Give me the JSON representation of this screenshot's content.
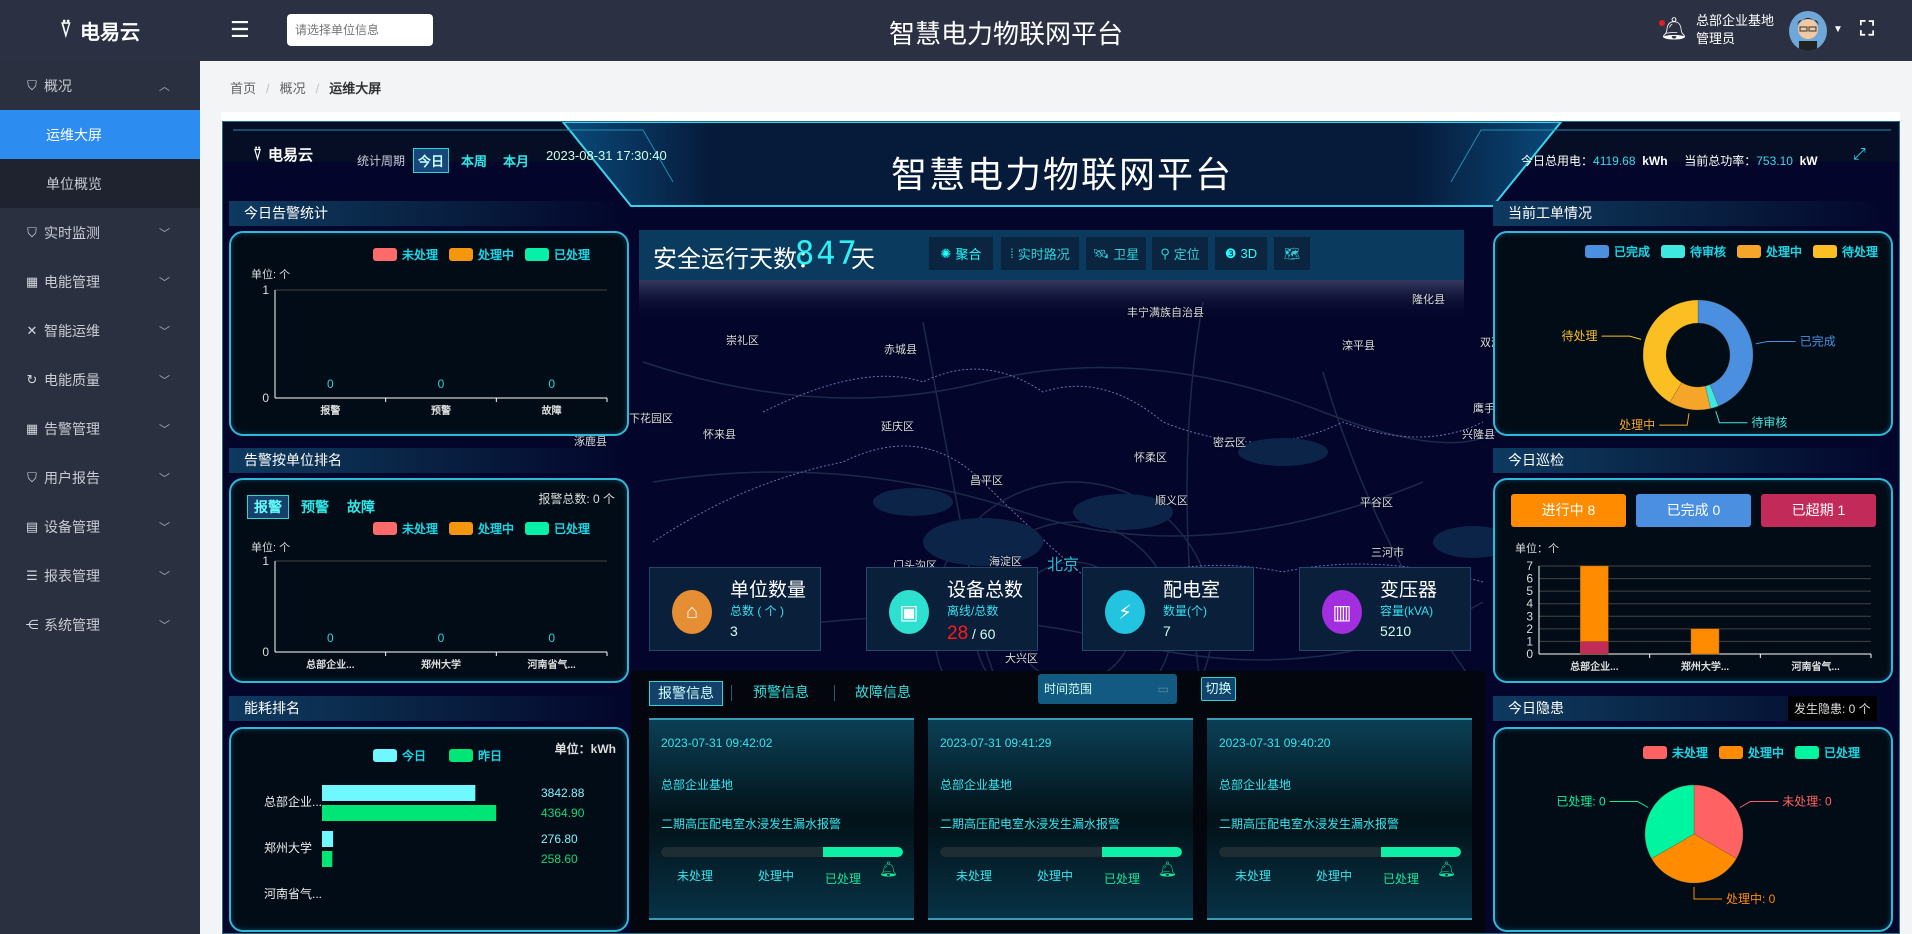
{
  "sidebar": {
    "logo": "电易云",
    "items": [
      {
        "label": "概况",
        "icon": "shield-icon",
        "expanded": true,
        "children": [
          {
            "label": "运维大屏",
            "active": true
          },
          {
            "label": "单位概览"
          }
        ]
      },
      {
        "label": "实时监测",
        "icon": "shield-icon"
      },
      {
        "label": "电能管理",
        "icon": "grid-icon"
      },
      {
        "label": "智能运维",
        "icon": "tools-icon"
      },
      {
        "label": "电能质量",
        "icon": "power-cycle-icon"
      },
      {
        "label": "告警管理",
        "icon": "grid-icon"
      },
      {
        "label": "用户报告",
        "icon": "shield-icon"
      },
      {
        "label": "设备管理",
        "icon": "device-icon"
      },
      {
        "label": "报表管理",
        "icon": "report-icon"
      },
      {
        "label": "系统管理",
        "icon": "share-icon"
      }
    ]
  },
  "topbar": {
    "unit_placeholder": "请选择单位信息",
    "title": "智慧电力物联网平台",
    "user_org": "总部企业基地",
    "user_role": "管理员"
  },
  "breadcrumb": [
    "首页",
    "概况",
    "运维大屏"
  ],
  "dashboard": {
    "logo": "电易云",
    "period_label": "统计周期",
    "periods": [
      "今日",
      "本周",
      "本月"
    ],
    "active_period": "今日",
    "datetime": "2023-08-31 17:30:40",
    "title": "智慧电力物联网平台",
    "today_power_label": "今日总用电：",
    "today_power": "4119.68",
    "today_power_unit": "kWh",
    "current_load_label": "当前总功率：",
    "current_load": "753.10",
    "current_load_unit": "kW",
    "safe_days_label": "安全运行天数：",
    "safe_days": "847",
    "safe_days_unit": "天",
    "map_tools": [
      {
        "label": "聚合",
        "icon": "cluster-icon"
      },
      {
        "label": "实时路况",
        "icon": "traffic-icon"
      },
      {
        "label": "卫星",
        "icon": "satellite-icon"
      },
      {
        "label": "定位",
        "icon": "location-icon"
      },
      {
        "label": "3D",
        "icon": "3d-icon"
      },
      {
        "label": "",
        "icon": "map-icon"
      }
    ],
    "map_labels": [
      "丰宁满族自治县",
      "隆化县",
      "崇礼区",
      "赤城县",
      "滦平县",
      "双滦区",
      "下花园区",
      "怀来县",
      "延庆区",
      "涿鹿县",
      "密云区",
      "怀柔区",
      "昌平区",
      "顺义区",
      "平谷区",
      "兴隆县",
      "鹰手",
      "三河市",
      "门头沟区",
      "海淀区",
      "北京",
      "大兴区"
    ],
    "stats": [
      {
        "title": "单位数量",
        "sub": "总数 ( 个 )",
        "value": "3",
        "icon": "home-icon",
        "color": "#e58e33"
      },
      {
        "title": "设备总数",
        "sub": "离线/总数",
        "offline": "28",
        "total": "/ 60",
        "icon": "device-icon",
        "color": "#2ee0d0"
      },
      {
        "title": "配电室",
        "sub": "数量(个)",
        "value": "7",
        "icon": "power-room-icon",
        "color": "#22c4e0"
      },
      {
        "title": "变压器",
        "sub": "容量(kVA)",
        "value": "5210",
        "icon": "transformer-icon",
        "color": "#a22ee0"
      }
    ],
    "alarm_tabs": [
      "报警信息",
      "预警信息",
      "故障信息"
    ],
    "time_range_placeholder": "时间范围",
    "switch_label": "切换",
    "alarm_cards": [
      {
        "time": "2023-07-31 09:42:02",
        "unit": "总部企业基地",
        "desc": "二期高压配电室水浸发生漏水报警",
        "progress": 0.33
      },
      {
        "time": "2023-07-31 09:41:29",
        "unit": "总部企业基地",
        "desc": "二期高压配电室水浸发生漏水报警",
        "progress": 0.33
      },
      {
        "time": "2023-07-31 09:40:20",
        "unit": "总部企业基地",
        "desc": "二期高压配电室水浸发生漏水报警",
        "progress": 0.33
      }
    ],
    "alarm_steps": [
      "未处理",
      "处理中",
      "已处理"
    ],
    "panels": {
      "alarm_today": "今日告警统计",
      "alarm_rank": "告警按单位排名",
      "energy_rank": "能耗排名",
      "work_orders": "当前工单情况",
      "patrol": "今日巡检",
      "hazards": "今日隐患"
    },
    "rank_tabs": [
      "报警",
      "预警",
      "故障"
    ],
    "rank_total": "报警总数: 0 个",
    "patrol_buttons": [
      {
        "label": "进行中 8",
        "color": "#ff8c00"
      },
      {
        "label": "已完成 0",
        "color": "#4a8fe0"
      },
      {
        "label": "已超期 1",
        "color": "#c22a5a"
      }
    ],
    "hazard_total": "发生隐患: 0 个"
  },
  "chart_data": [
    {
      "id": "alarm_today",
      "type": "bar",
      "unit_label": "单位: 个",
      "categories": [
        "报警",
        "预警",
        "故障"
      ],
      "values": [
        0,
        0,
        0
      ],
      "ylim": [
        0,
        1
      ],
      "yticks": [
        "0",
        "1"
      ],
      "legend": [
        {
          "name": "未处理",
          "color": "#ff6b6b"
        },
        {
          "name": "处理中",
          "color": "#f5960f"
        },
        {
          "name": "已处理",
          "color": "#08f0a8"
        }
      ]
    },
    {
      "id": "alarm_rank",
      "type": "bar",
      "unit_label": "单位: 个",
      "categories": [
        "总部企业...",
        "郑州大学",
        "河南省气..."
      ],
      "values": [
        0,
        0,
        0
      ],
      "ylim": [
        0,
        1
      ],
      "yticks": [
        "0",
        "1"
      ],
      "legend": [
        {
          "name": "未处理",
          "color": "#ff6b6b"
        },
        {
          "name": "处理中",
          "color": "#f5960f"
        },
        {
          "name": "已处理",
          "color": "#08f0a8"
        }
      ]
    },
    {
      "id": "energy_rank",
      "type": "bar",
      "orientation": "horizontal",
      "unit_label": "单位：kWh",
      "categories": [
        "总部企业...",
        "郑州大学",
        "河南省气..."
      ],
      "series": [
        {
          "name": "今日",
          "color": "#6ff8ff",
          "values": [
            3842.88,
            276.8,
            null
          ],
          "labels": [
            "3842.88",
            "276.80",
            ""
          ]
        },
        {
          "name": "昨日",
          "color": "#00e676",
          "values": [
            4364.9,
            258.6,
            null
          ],
          "labels": [
            "4364.90",
            "258.60",
            ""
          ]
        }
      ],
      "xlim": [
        0,
        4400
      ]
    },
    {
      "id": "work_orders",
      "type": "pie",
      "donut": true,
      "labels": [
        "已完成",
        "待审核",
        "处理中",
        "待处理"
      ],
      "values": [
        18,
        1,
        5,
        17
      ],
      "colors": [
        "#4a8fe0",
        "#3ee8e0",
        "#f5a52a",
        "#fbbf24"
      ]
    },
    {
      "id": "patrol",
      "type": "bar",
      "stacked": true,
      "unit_label": "单位：个",
      "categories": [
        "总部企业...",
        "郑州大学...",
        "河南省气..."
      ],
      "series": [
        {
          "name": "已超期",
          "color": "#c22a5a",
          "values": [
            1,
            0,
            0
          ]
        },
        {
          "name": "进行中",
          "color": "#ff8c00",
          "values": [
            6,
            2,
            0
          ]
        }
      ],
      "ylim": [
        0,
        7
      ],
      "yticks": [
        "0",
        "1",
        "2",
        "3",
        "4",
        "5",
        "6",
        "7"
      ]
    },
    {
      "id": "hazards",
      "type": "pie",
      "labels": [
        "未处理",
        "处理中",
        "已处理"
      ],
      "values": [
        0,
        0,
        0
      ],
      "slice_labels": [
        "未处理: 0",
        "处理中: 0",
        "已处理: 0"
      ],
      "colors": [
        "#ff6262",
        "#ff8c00",
        "#00f5a0"
      ]
    }
  ]
}
